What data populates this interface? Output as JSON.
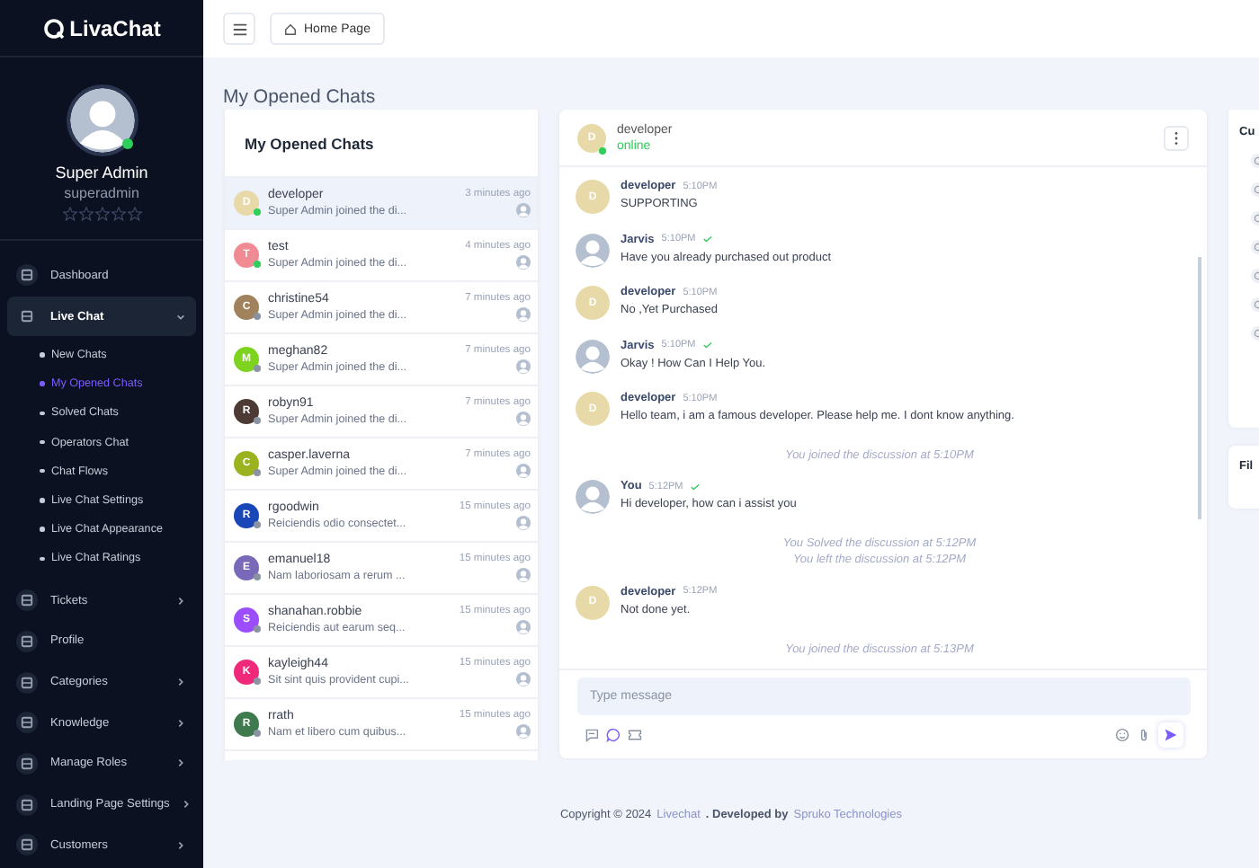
{
  "brand": {
    "name": "LivaChat"
  },
  "profile": {
    "name": "Super Admin",
    "role": "superadmin",
    "online": true,
    "stars": 0
  },
  "sidebar": {
    "items": [
      {
        "label": "Dashboard",
        "has_submenu": false,
        "selected": false
      },
      {
        "label": "Live Chat",
        "has_submenu": true,
        "selected": true,
        "expanded": true,
        "children": [
          {
            "label": "New Chats",
            "selected": false
          },
          {
            "label": "My Opened Chats",
            "selected": true
          },
          {
            "label": "Solved Chats",
            "selected": false
          },
          {
            "label": "Operators Chat",
            "selected": false
          },
          {
            "label": "Chat Flows",
            "selected": false
          },
          {
            "label": "Live Chat Settings",
            "selected": false
          },
          {
            "label": "Live Chat Appearance",
            "selected": false
          },
          {
            "label": "Live Chat Ratings",
            "selected": false
          }
        ]
      },
      {
        "label": "Tickets",
        "has_submenu": true,
        "selected": false
      },
      {
        "label": "Profile",
        "has_submenu": false,
        "selected": false
      },
      {
        "label": "Categories",
        "has_submenu": true,
        "selected": false
      },
      {
        "label": "Knowledge",
        "has_submenu": true,
        "selected": false
      },
      {
        "label": "Manage Roles",
        "has_submenu": true,
        "selected": false
      },
      {
        "label": "Landing Page Settings",
        "has_submenu": true,
        "selected": false
      },
      {
        "label": "Customers",
        "has_submenu": true,
        "selected": false
      }
    ]
  },
  "header": {
    "breadcrumb": "Home Page"
  },
  "page_title": "My Opened Chats",
  "chat_list": {
    "title": "My Opened Chats",
    "items": [
      {
        "initial": "D",
        "name": "developer",
        "snippet": "Super Admin joined the di...",
        "time": "3 minutes ago",
        "color": "#e8d9a8",
        "online": true,
        "selected": true
      },
      {
        "initial": "T",
        "name": "test",
        "snippet": "Super Admin joined the di...",
        "time": "4 minutes ago",
        "color": "#f08a93",
        "online": true,
        "selected": false
      },
      {
        "initial": "C",
        "name": "christine54",
        "snippet": "Super Admin joined the di...",
        "time": "7 minutes ago",
        "color": "#a0835c",
        "online": false,
        "selected": false
      },
      {
        "initial": "M",
        "name": "meghan82",
        "snippet": "Super Admin joined the di...",
        "time": "7 minutes ago",
        "color": "#7ed321",
        "online": false,
        "selected": false
      },
      {
        "initial": "R",
        "name": "robyn91",
        "snippet": "Super Admin joined the di...",
        "time": "7 minutes ago",
        "color": "#4e3a35",
        "online": false,
        "selected": false
      },
      {
        "initial": "C",
        "name": "casper.laverna",
        "snippet": "Super Admin joined the di...",
        "time": "7 minutes ago",
        "color": "#9cb320",
        "online": false,
        "selected": false
      },
      {
        "initial": "R",
        "name": "rgoodwin",
        "snippet": "Reiciendis odio consectet...",
        "time": "15 minutes ago",
        "color": "#1a47b8",
        "online": false,
        "selected": false
      },
      {
        "initial": "E",
        "name": "emanuel18",
        "snippet": "Nam laboriosam a rerum ...",
        "time": "15 minutes ago",
        "color": "#7a68b8",
        "online": false,
        "selected": false
      },
      {
        "initial": "S",
        "name": "shanahan.robbie",
        "snippet": "Reiciendis aut earum seq...",
        "time": "15 minutes ago",
        "color": "#9b4dff",
        "online": false,
        "selected": false
      },
      {
        "initial": "K",
        "name": "kayleigh44",
        "snippet": "Sit sint quis provident cupi...",
        "time": "15 minutes ago",
        "color": "#f0287a",
        "online": false,
        "selected": false
      },
      {
        "initial": "R",
        "name": "rrath",
        "snippet": "Nam et libero cum quibus...",
        "time": "15 minutes ago",
        "color": "#3f7a4f",
        "online": false,
        "selected": false
      }
    ]
  },
  "chat": {
    "contact": {
      "initial": "D",
      "name": "developer",
      "status": "online",
      "online": true
    },
    "messages": [
      {
        "kind": "message",
        "initial": "D",
        "author": "developer",
        "time": "5:10PM",
        "text": "SUPPORTING",
        "read": false
      },
      {
        "kind": "message",
        "author": "Jarvis",
        "time": "5:10PM",
        "text": "Have you already purchased out product",
        "read": true
      },
      {
        "kind": "message",
        "initial": "D",
        "author": "developer",
        "time": "5:10PM",
        "text": "No ,Yet Purchased",
        "read": false
      },
      {
        "kind": "message",
        "author": "Jarvis",
        "time": "5:10PM",
        "text": "Okay ! How Can I Help You.",
        "read": true
      },
      {
        "kind": "message",
        "initial": "D",
        "author": "developer",
        "time": "5:10PM",
        "text": "Hello team, i am a famous developer. Please help me. I dont know anything.",
        "read": false
      },
      {
        "kind": "system",
        "text": "You joined the discussion at 5:10PM"
      },
      {
        "kind": "message",
        "author": "You",
        "time": "5:12PM",
        "text": "Hi developer, how can i assist you",
        "read": true
      },
      {
        "kind": "system",
        "text": "You Solved the discussion at 5:12PM"
      },
      {
        "kind": "system",
        "text": "You left the discussion at 5:12PM"
      },
      {
        "kind": "message",
        "initial": "D",
        "author": "developer",
        "time": "5:12PM",
        "text": "Not done yet.",
        "read": false
      },
      {
        "kind": "system",
        "text": "You joined the discussion at 5:13PM"
      }
    ],
    "composer": {
      "placeholder": "Type message"
    }
  },
  "side_panels": [
    {
      "title": "Cu"
    },
    {
      "title": "Fil"
    }
  ],
  "footer": {
    "prefix": "Copyright © 2024",
    "link1": "Livechat",
    "middle": ". Developed by",
    "link2": "Spruko Technologies"
  }
}
